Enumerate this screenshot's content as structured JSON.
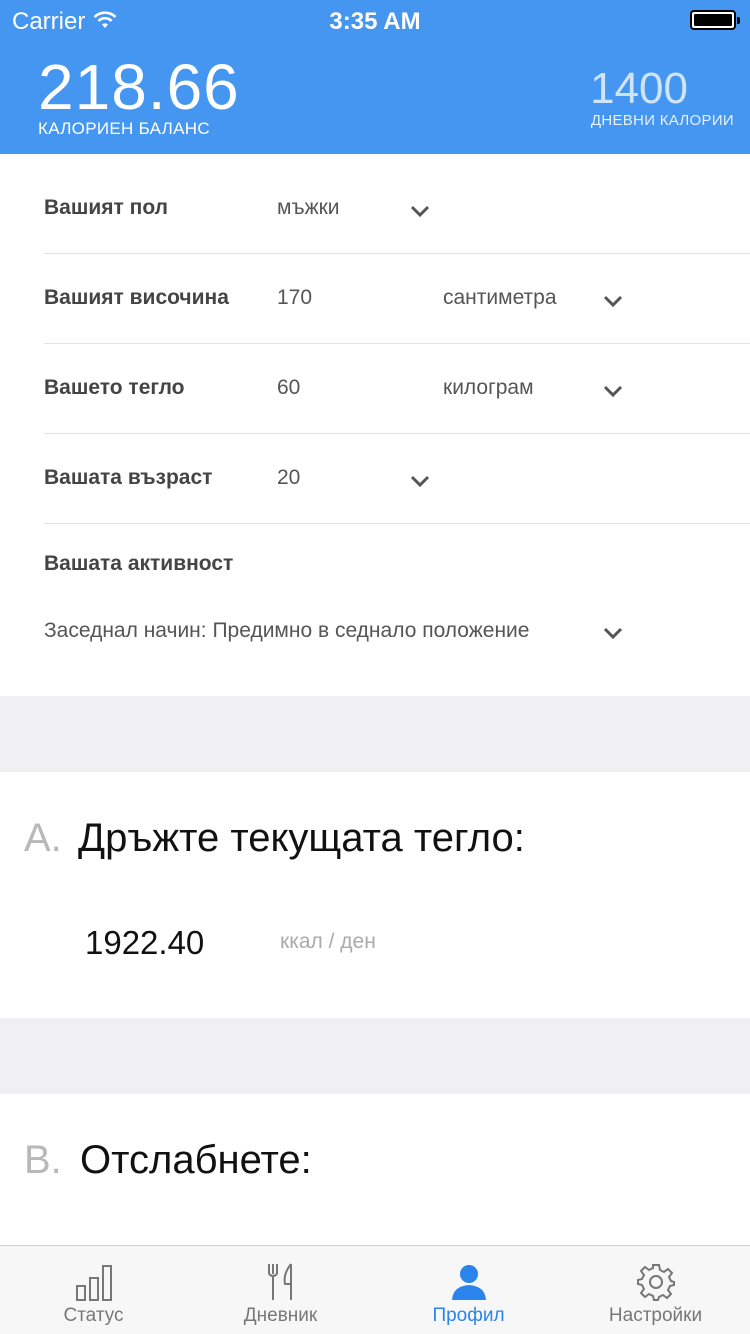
{
  "status_bar": {
    "carrier": "Carrier",
    "time": "3:35 AM"
  },
  "header": {
    "balance_value": "218.66",
    "balance_label": "КАЛОРИЕН БАЛАНС",
    "daily_value": "1400",
    "daily_label": "ДНЕВНИ КАЛОРИИ"
  },
  "form": {
    "gender": {
      "label": "Вашият пол",
      "value": "мъжки"
    },
    "height": {
      "label": "Вашият височина",
      "value": "170",
      "unit": "сантиметра"
    },
    "weight": {
      "label": "Вашето тегло",
      "value": "60",
      "unit": "килограм"
    },
    "age": {
      "label": "Вашата възраст",
      "value": "20"
    },
    "activity": {
      "label": "Вашата активност",
      "value": "Заседнал начин: Предимно в седнало положение"
    }
  },
  "section_a": {
    "letter": "A.",
    "title": "Дръжте текущата тегло:",
    "value": "1922.40",
    "unit": "ккал / ден"
  },
  "section_b": {
    "letter": "B.",
    "title": "Отслабнете:"
  },
  "tabs": [
    {
      "label": "Статус",
      "icon": "bar-chart-icon",
      "active": false
    },
    {
      "label": "Дневник",
      "icon": "fork-knife-icon",
      "active": false
    },
    {
      "label": "Профил",
      "icon": "user-icon",
      "active": true
    },
    {
      "label": "Настройки",
      "icon": "gear-icon",
      "active": false
    }
  ],
  "colors": {
    "header": "#4596f0",
    "active_tab": "#2a84ec"
  }
}
